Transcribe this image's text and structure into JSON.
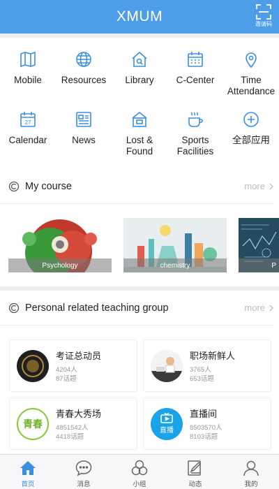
{
  "header": {
    "title": "XMUM",
    "scan_label": "邀请码"
  },
  "menu": {
    "row1": [
      {
        "label": "Mobile",
        "icon": "mobile-icon"
      },
      {
        "label": "Resources",
        "icon": "globe-icon"
      },
      {
        "label": "Library",
        "icon": "library-icon"
      },
      {
        "label": "C-Center",
        "icon": "calendar-grid-icon"
      },
      {
        "label": "Time Attendance",
        "icon": "location-pin-icon"
      }
    ],
    "row2": [
      {
        "label": "Calendar",
        "icon": "calendar-icon"
      },
      {
        "label": "News",
        "icon": "news-icon"
      },
      {
        "label": "Lost & Found",
        "icon": "box-icon"
      },
      {
        "label": "Sports Facilities",
        "icon": "cup-icon"
      },
      {
        "label": "全部应用",
        "icon": "plus-circle-icon"
      }
    ],
    "calendar_day": "27"
  },
  "my_course": {
    "title": "My course",
    "more": "more",
    "courses": [
      {
        "caption": "Psychology"
      },
      {
        "caption": "chemistry"
      },
      {
        "caption": "P"
      }
    ]
  },
  "teaching_group": {
    "title": "Personal related teaching group",
    "more": "more",
    "groups": [
      {
        "name": "考证总动员",
        "members": "4204人",
        "topics": "87话题"
      },
      {
        "name": "职场新鲜人",
        "members": "3765人",
        "topics": "653话题"
      },
      {
        "name": "青春大秀场",
        "members": "4851542人",
        "topics": "4418话题",
        "avatar_text": "青春"
      },
      {
        "name": "直播间",
        "members": "8503570人",
        "topics": "8103话题",
        "avatar_text": "直播"
      }
    ]
  },
  "tabbar": [
    {
      "label": "首页",
      "icon": "home-icon",
      "active": true
    },
    {
      "label": "消息",
      "icon": "message-icon",
      "active": false
    },
    {
      "label": "小组",
      "icon": "group-icon",
      "active": false
    },
    {
      "label": "动态",
      "icon": "edit-icon",
      "active": false
    },
    {
      "label": "我的",
      "icon": "user-icon",
      "active": false
    }
  ],
  "colors": {
    "header": "#4d9de8",
    "icon": "#3b8fe0",
    "active_tab": "#3b8fe0"
  }
}
